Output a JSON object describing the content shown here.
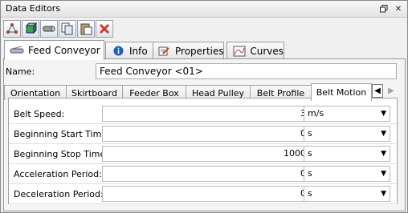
{
  "window": {
    "title": "Data Editors"
  },
  "toolbar": {
    "buttons": [
      {
        "icon": "network-icon"
      },
      {
        "icon": "cube-icon"
      },
      {
        "icon": "pipe-icon"
      },
      {
        "icon": "copy-icon"
      },
      {
        "icon": "paste-icon"
      },
      {
        "icon": "delete-icon"
      }
    ]
  },
  "main_tabs": [
    {
      "label": "Feed Conveyor",
      "icon": "conveyor-icon"
    },
    {
      "label": "Info",
      "icon": "info-icon"
    },
    {
      "label": "Properties",
      "icon": "properties-icon"
    },
    {
      "label": "Curves",
      "icon": "curves-icon"
    }
  ],
  "name_field": {
    "label": "Name:",
    "value": "Feed Conveyor <01>"
  },
  "sub_tabs": [
    {
      "label": "Orientation"
    },
    {
      "label": "Skirtboard"
    },
    {
      "label": "Feeder Box"
    },
    {
      "label": "Head Pulley"
    },
    {
      "label": "Belt Profile"
    },
    {
      "label": "Belt Motion"
    }
  ],
  "properties": [
    {
      "label": "Belt Speed:",
      "value": "3",
      "unit": "m/s"
    },
    {
      "label": "Beginning Start Time:",
      "value": "0",
      "unit": "s"
    },
    {
      "label": "Beginning Stop Time:",
      "value": "1000",
      "unit": "s"
    },
    {
      "label": "Acceleration Period:",
      "value": "0",
      "unit": "s"
    },
    {
      "label": "Deceleration Period:",
      "value": "0",
      "unit": "s"
    }
  ],
  "colors": {
    "accent_red": "#d23a2a",
    "panel": "#f4f4f4"
  }
}
